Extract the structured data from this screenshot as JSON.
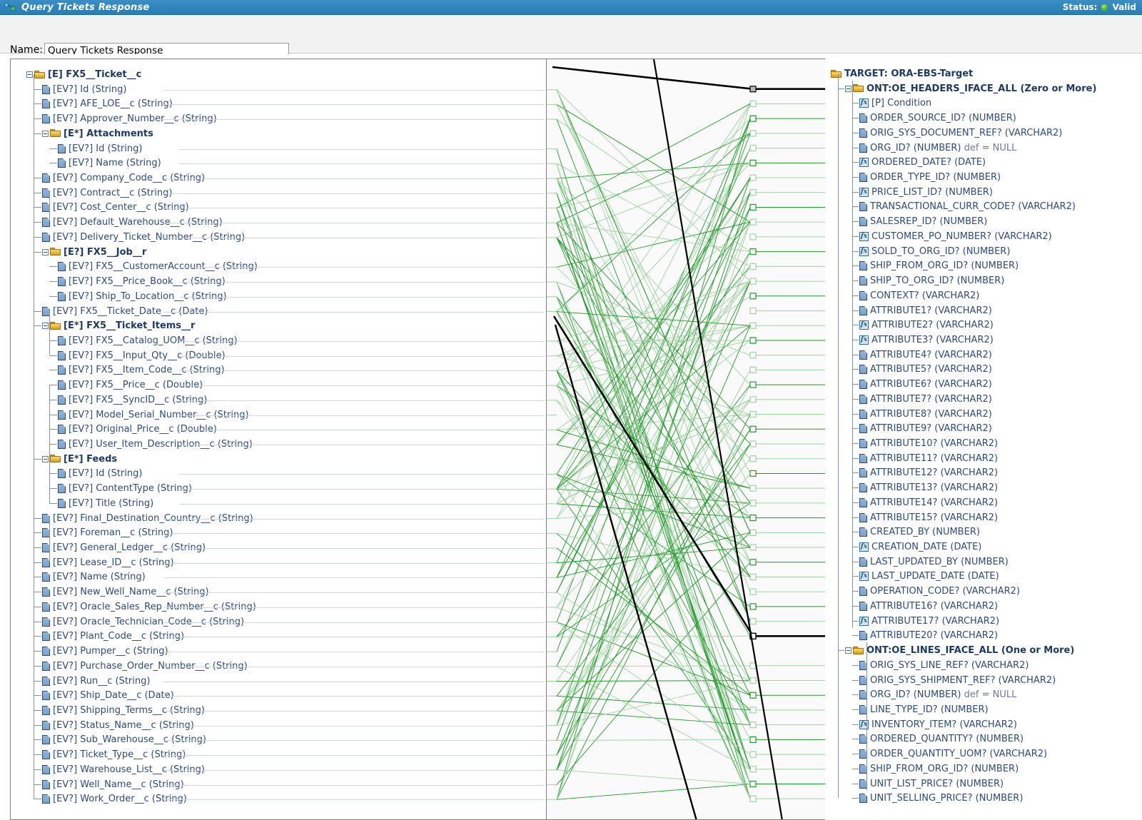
{
  "window": {
    "title": "Query Tickets Response",
    "icon": "mapping-icon",
    "status_label": "Status:",
    "status_value": "Valid",
    "status_color": "#3fc32b"
  },
  "form": {
    "name_label": "Name:",
    "name_value": "Query Tickets Response",
    "name_placeholder": "Name"
  },
  "source_tree": {
    "root": "[E] FX5__Ticket__c",
    "nodes": [
      {
        "depth": 0,
        "kind": "folder",
        "prefix": "[E]",
        "label": "FX5__Ticket__c",
        "type": "",
        "group": true,
        "expander": true
      },
      {
        "depth": 1,
        "kind": "doc",
        "prefix": "[EV?]",
        "label": "Id",
        "type": "(String)"
      },
      {
        "depth": 1,
        "kind": "doc",
        "prefix": "[EV?]",
        "label": "AFE_LOE__c",
        "type": "(String)"
      },
      {
        "depth": 1,
        "kind": "doc",
        "prefix": "[EV?]",
        "label": "Approver_Number__c",
        "type": "(String)"
      },
      {
        "depth": 1,
        "kind": "folder",
        "prefix": "[E*]",
        "label": "Attachments",
        "type": "",
        "group": true,
        "expander": true
      },
      {
        "depth": 2,
        "kind": "doc",
        "prefix": "[EV?]",
        "label": "Id",
        "type": "(String)"
      },
      {
        "depth": 2,
        "kind": "doc",
        "prefix": "[EV?]",
        "label": "Name",
        "type": "(String)"
      },
      {
        "depth": 1,
        "kind": "doc",
        "prefix": "[EV?]",
        "label": "Company_Code__c",
        "type": "(String)"
      },
      {
        "depth": 1,
        "kind": "doc",
        "prefix": "[EV?]",
        "label": "Contract__c",
        "type": "(String)"
      },
      {
        "depth": 1,
        "kind": "doc",
        "prefix": "[EV?]",
        "label": "Cost_Center__c",
        "type": "(String)"
      },
      {
        "depth": 1,
        "kind": "doc",
        "prefix": "[EV?]",
        "label": "Default_Warehouse__c",
        "type": "(String)"
      },
      {
        "depth": 1,
        "kind": "doc",
        "prefix": "[EV?]",
        "label": "Delivery_Ticket_Number__c",
        "type": "(String)"
      },
      {
        "depth": 1,
        "kind": "folder",
        "prefix": "[E?]",
        "label": "FX5__Job__r",
        "type": "",
        "group": true,
        "expander": true
      },
      {
        "depth": 2,
        "kind": "doc",
        "prefix": "[EV?]",
        "label": "FX5__CustomerAccount__c",
        "type": "(String)"
      },
      {
        "depth": 2,
        "kind": "doc",
        "prefix": "[EV?]",
        "label": "FX5__Price_Book__c",
        "type": "(String)"
      },
      {
        "depth": 2,
        "kind": "doc",
        "prefix": "[EV?]",
        "label": "Ship_To_Location__c",
        "type": "(String)"
      },
      {
        "depth": 1,
        "kind": "doc",
        "prefix": "[EV?]",
        "label": "FX5__Ticket_Date__c",
        "type": "(Date)"
      },
      {
        "depth": 1,
        "kind": "folder",
        "prefix": "[E*]",
        "label": "FX5__Ticket_Items__r",
        "type": "",
        "group": true,
        "expander": true
      },
      {
        "depth": 2,
        "kind": "doc",
        "prefix": "[EV?]",
        "label": "FX5__Catalog_UOM__c",
        "type": "(String)"
      },
      {
        "depth": 2,
        "kind": "doc",
        "prefix": "[EV?]",
        "label": "FX5__Input_Qty__c",
        "type": "(Double)"
      },
      {
        "depth": 2,
        "kind": "doc",
        "prefix": "[EV?]",
        "label": "FX5__Item_Code__c",
        "type": "(String)"
      },
      {
        "depth": 2,
        "kind": "doc",
        "prefix": "[EV?]",
        "label": "FX5__Price__c",
        "type": "(Double)"
      },
      {
        "depth": 2,
        "kind": "doc",
        "prefix": "[EV?]",
        "label": "FX5__SyncID__c",
        "type": "(String)"
      },
      {
        "depth": 2,
        "kind": "doc",
        "prefix": "[EV?]",
        "label": "Model_Serial_Number__c",
        "type": "(String)"
      },
      {
        "depth": 2,
        "kind": "doc",
        "prefix": "[EV?]",
        "label": "Original_Price__c",
        "type": "(Double)"
      },
      {
        "depth": 2,
        "kind": "doc",
        "prefix": "[EV?]",
        "label": "User_Item_Description__c",
        "type": "(String)"
      },
      {
        "depth": 1,
        "kind": "folder",
        "prefix": "[E*]",
        "label": "Feeds",
        "type": "",
        "group": true,
        "expander": true
      },
      {
        "depth": 2,
        "kind": "doc",
        "prefix": "[EV?]",
        "label": "Id",
        "type": "(String)"
      },
      {
        "depth": 2,
        "kind": "doc",
        "prefix": "[EV?]",
        "label": "ContentType",
        "type": "(String)"
      },
      {
        "depth": 2,
        "kind": "doc",
        "prefix": "[EV?]",
        "label": "Title",
        "type": "(String)"
      },
      {
        "depth": 1,
        "kind": "doc",
        "prefix": "[EV?]",
        "label": "Final_Destination_Country__c",
        "type": "(String)"
      },
      {
        "depth": 1,
        "kind": "doc",
        "prefix": "[EV?]",
        "label": "Foreman__c",
        "type": "(String)"
      },
      {
        "depth": 1,
        "kind": "doc",
        "prefix": "[EV?]",
        "label": "General_Ledger__c",
        "type": "(String)"
      },
      {
        "depth": 1,
        "kind": "doc",
        "prefix": "[EV?]",
        "label": "Lease_ID__c",
        "type": "(String)"
      },
      {
        "depth": 1,
        "kind": "doc",
        "prefix": "[EV?]",
        "label": "Name",
        "type": "(String)"
      },
      {
        "depth": 1,
        "kind": "doc",
        "prefix": "[EV?]",
        "label": "New_Well_Name__c",
        "type": "(String)"
      },
      {
        "depth": 1,
        "kind": "doc",
        "prefix": "[EV?]",
        "label": "Oracle_Sales_Rep_Number__c",
        "type": "(String)"
      },
      {
        "depth": 1,
        "kind": "doc",
        "prefix": "[EV?]",
        "label": "Oracle_Technician_Code__c",
        "type": "(String)"
      },
      {
        "depth": 1,
        "kind": "doc",
        "prefix": "[EV?]",
        "label": "Plant_Code__c",
        "type": "(String)"
      },
      {
        "depth": 1,
        "kind": "doc",
        "prefix": "[EV?]",
        "label": "Pumper__c",
        "type": "(String)"
      },
      {
        "depth": 1,
        "kind": "doc",
        "prefix": "[EV?]",
        "label": "Purchase_Order_Number__c",
        "type": "(String)"
      },
      {
        "depth": 1,
        "kind": "doc",
        "prefix": "[EV?]",
        "label": "Run__c",
        "type": "(String)"
      },
      {
        "depth": 1,
        "kind": "doc",
        "prefix": "[EV?]",
        "label": "Ship_Date__c",
        "type": "(Date)"
      },
      {
        "depth": 1,
        "kind": "doc",
        "prefix": "[EV?]",
        "label": "Shipping_Terms__c",
        "type": "(String)"
      },
      {
        "depth": 1,
        "kind": "doc",
        "prefix": "[EV?]",
        "label": "Status_Name__c",
        "type": "(String)"
      },
      {
        "depth": 1,
        "kind": "doc",
        "prefix": "[EV?]",
        "label": "Sub_Warehouse__c",
        "type": "(String)"
      },
      {
        "depth": 1,
        "kind": "doc",
        "prefix": "[EV?]",
        "label": "Ticket_Type__c",
        "type": "(String)"
      },
      {
        "depth": 1,
        "kind": "doc",
        "prefix": "[EV?]",
        "label": "Warehouse_List__c",
        "type": "(String)"
      },
      {
        "depth": 1,
        "kind": "doc",
        "prefix": "[EV?]",
        "label": "Well_Name__c",
        "type": "(String)"
      },
      {
        "depth": 1,
        "kind": "doc",
        "prefix": "[EV?]",
        "label": "Work_Order__c",
        "type": "(String)"
      }
    ]
  },
  "target_tree": {
    "root": "TARGET: ORA-EBS-Target",
    "nodes": [
      {
        "depth": 0,
        "kind": "folder",
        "prefix": "",
        "label": "TARGET: ORA-EBS-Target",
        "type": "",
        "group": true,
        "expander": false
      },
      {
        "depth": 1,
        "kind": "folder",
        "prefix": "",
        "label": "ONT:OE_HEADERS_IFACE_ALL (Zero or More)",
        "type": "",
        "group": true,
        "expander": true
      },
      {
        "depth": 2,
        "kind": "fx",
        "prefix": "[P]",
        "label": "Condition",
        "type": ""
      },
      {
        "depth": 2,
        "kind": "doc",
        "prefix": "",
        "label": "ORDER_SOURCE_ID?",
        "type": "(NUMBER)"
      },
      {
        "depth": 2,
        "kind": "doc",
        "prefix": "",
        "label": "ORIG_SYS_DOCUMENT_REF?",
        "type": "(VARCHAR2)"
      },
      {
        "depth": 2,
        "kind": "doc",
        "prefix": "",
        "label": "ORG_ID?",
        "type": "(NUMBER)",
        "suffix": "def = NULL"
      },
      {
        "depth": 2,
        "kind": "fx",
        "prefix": "",
        "label": "ORDERED_DATE?",
        "type": "(DATE)"
      },
      {
        "depth": 2,
        "kind": "doc",
        "prefix": "",
        "label": "ORDER_TYPE_ID?",
        "type": "(NUMBER)"
      },
      {
        "depth": 2,
        "kind": "fx",
        "prefix": "",
        "label": "PRICE_LIST_ID?",
        "type": "(NUMBER)"
      },
      {
        "depth": 2,
        "kind": "doc",
        "prefix": "",
        "label": "TRANSACTIONAL_CURR_CODE?",
        "type": "(VARCHAR2)"
      },
      {
        "depth": 2,
        "kind": "doc",
        "prefix": "",
        "label": "SALESREP_ID?",
        "type": "(NUMBER)"
      },
      {
        "depth": 2,
        "kind": "fx",
        "prefix": "",
        "label": "CUSTOMER_PO_NUMBER?",
        "type": "(VARCHAR2)"
      },
      {
        "depth": 2,
        "kind": "fx",
        "prefix": "",
        "label": "SOLD_TO_ORG_ID?",
        "type": "(NUMBER)"
      },
      {
        "depth": 2,
        "kind": "doc",
        "prefix": "",
        "label": "SHIP_FROM_ORG_ID?",
        "type": "(NUMBER)"
      },
      {
        "depth": 2,
        "kind": "doc",
        "prefix": "",
        "label": "SHIP_TO_ORG_ID?",
        "type": "(NUMBER)"
      },
      {
        "depth": 2,
        "kind": "doc",
        "prefix": "",
        "label": "CONTEXT?",
        "type": "(VARCHAR2)"
      },
      {
        "depth": 2,
        "kind": "doc",
        "prefix": "",
        "label": "ATTRIBUTE1?",
        "type": "(VARCHAR2)"
      },
      {
        "depth": 2,
        "kind": "fx",
        "prefix": "",
        "label": "ATTRIBUTE2?",
        "type": "(VARCHAR2)"
      },
      {
        "depth": 2,
        "kind": "fx",
        "prefix": "",
        "label": "ATTRIBUTE3?",
        "type": "(VARCHAR2)"
      },
      {
        "depth": 2,
        "kind": "doc",
        "prefix": "",
        "label": "ATTRIBUTE4?",
        "type": "(VARCHAR2)"
      },
      {
        "depth": 2,
        "kind": "doc",
        "prefix": "",
        "label": "ATTRIBUTE5?",
        "type": "(VARCHAR2)"
      },
      {
        "depth": 2,
        "kind": "doc",
        "prefix": "",
        "label": "ATTRIBUTE6?",
        "type": "(VARCHAR2)"
      },
      {
        "depth": 2,
        "kind": "doc",
        "prefix": "",
        "label": "ATTRIBUTE7?",
        "type": "(VARCHAR2)"
      },
      {
        "depth": 2,
        "kind": "doc",
        "prefix": "",
        "label": "ATTRIBUTE8?",
        "type": "(VARCHAR2)"
      },
      {
        "depth": 2,
        "kind": "doc",
        "prefix": "",
        "label": "ATTRIBUTE9?",
        "type": "(VARCHAR2)"
      },
      {
        "depth": 2,
        "kind": "doc",
        "prefix": "",
        "label": "ATTRIBUTE10?",
        "type": "(VARCHAR2)"
      },
      {
        "depth": 2,
        "kind": "doc",
        "prefix": "",
        "label": "ATTRIBUTE11?",
        "type": "(VARCHAR2)"
      },
      {
        "depth": 2,
        "kind": "doc",
        "prefix": "",
        "label": "ATTRIBUTE12?",
        "type": "(VARCHAR2)"
      },
      {
        "depth": 2,
        "kind": "doc",
        "prefix": "",
        "label": "ATTRIBUTE13?",
        "type": "(VARCHAR2)"
      },
      {
        "depth": 2,
        "kind": "doc",
        "prefix": "",
        "label": "ATTRIBUTE14?",
        "type": "(VARCHAR2)"
      },
      {
        "depth": 2,
        "kind": "doc",
        "prefix": "",
        "label": "ATTRIBUTE15?",
        "type": "(VARCHAR2)"
      },
      {
        "depth": 2,
        "kind": "doc",
        "prefix": "",
        "label": "CREATED_BY",
        "type": "(NUMBER)"
      },
      {
        "depth": 2,
        "kind": "fx",
        "prefix": "",
        "label": "CREATION_DATE",
        "type": "(DATE)"
      },
      {
        "depth": 2,
        "kind": "doc",
        "prefix": "",
        "label": "LAST_UPDATED_BY",
        "type": "(NUMBER)"
      },
      {
        "depth": 2,
        "kind": "fx",
        "prefix": "",
        "label": "LAST_UPDATE_DATE",
        "type": "(DATE)"
      },
      {
        "depth": 2,
        "kind": "doc",
        "prefix": "",
        "label": "OPERATION_CODE?",
        "type": "(VARCHAR2)"
      },
      {
        "depth": 2,
        "kind": "doc",
        "prefix": "",
        "label": "ATTRIBUTE16?",
        "type": "(VARCHAR2)"
      },
      {
        "depth": 2,
        "kind": "fx",
        "prefix": "",
        "label": "ATTRIBUTE17?",
        "type": "(VARCHAR2)"
      },
      {
        "depth": 2,
        "kind": "doc",
        "prefix": "",
        "label": "ATTRIBUTE20?",
        "type": "(VARCHAR2)"
      },
      {
        "depth": 1,
        "kind": "folder",
        "prefix": "",
        "label": "ONT:OE_LINES_IFACE_ALL (One or More)",
        "type": "",
        "group": true,
        "expander": true
      },
      {
        "depth": 2,
        "kind": "doc",
        "prefix": "",
        "label": "ORIG_SYS_LINE_REF?",
        "type": "(VARCHAR2)"
      },
      {
        "depth": 2,
        "kind": "doc",
        "prefix": "",
        "label": "ORIG_SYS_SHIPMENT_REF?",
        "type": "(VARCHAR2)"
      },
      {
        "depth": 2,
        "kind": "doc",
        "prefix": "",
        "label": "ORG_ID?",
        "type": "(NUMBER)",
        "suffix": "def = NULL"
      },
      {
        "depth": 2,
        "kind": "doc",
        "prefix": "",
        "label": "LINE_TYPE_ID?",
        "type": "(NUMBER)"
      },
      {
        "depth": 2,
        "kind": "fx",
        "prefix": "",
        "label": "INVENTORY_ITEM?",
        "type": "(VARCHAR2)"
      },
      {
        "depth": 2,
        "kind": "doc",
        "prefix": "",
        "label": "ORDERED_QUANTITY?",
        "type": "(NUMBER)"
      },
      {
        "depth": 2,
        "kind": "doc",
        "prefix": "",
        "label": "ORDER_QUANTITY_UOM?",
        "type": "(VARCHAR2)"
      },
      {
        "depth": 2,
        "kind": "doc",
        "prefix": "",
        "label": "SHIP_FROM_ORG_ID?",
        "type": "(NUMBER)"
      },
      {
        "depth": 2,
        "kind": "doc",
        "prefix": "",
        "label": "UNIT_LIST_PRICE?",
        "type": "(NUMBER)"
      },
      {
        "depth": 2,
        "kind": "doc",
        "prefix": "",
        "label": "UNIT_SELLING_PRICE?",
        "type": "(NUMBER)"
      }
    ]
  },
  "mapping": {
    "connector_color": "#1f9a27",
    "connector_color_light": "#9ed3a0",
    "highlight_color": "#000000",
    "note": "green mapping lines connect source fields to target fields"
  }
}
